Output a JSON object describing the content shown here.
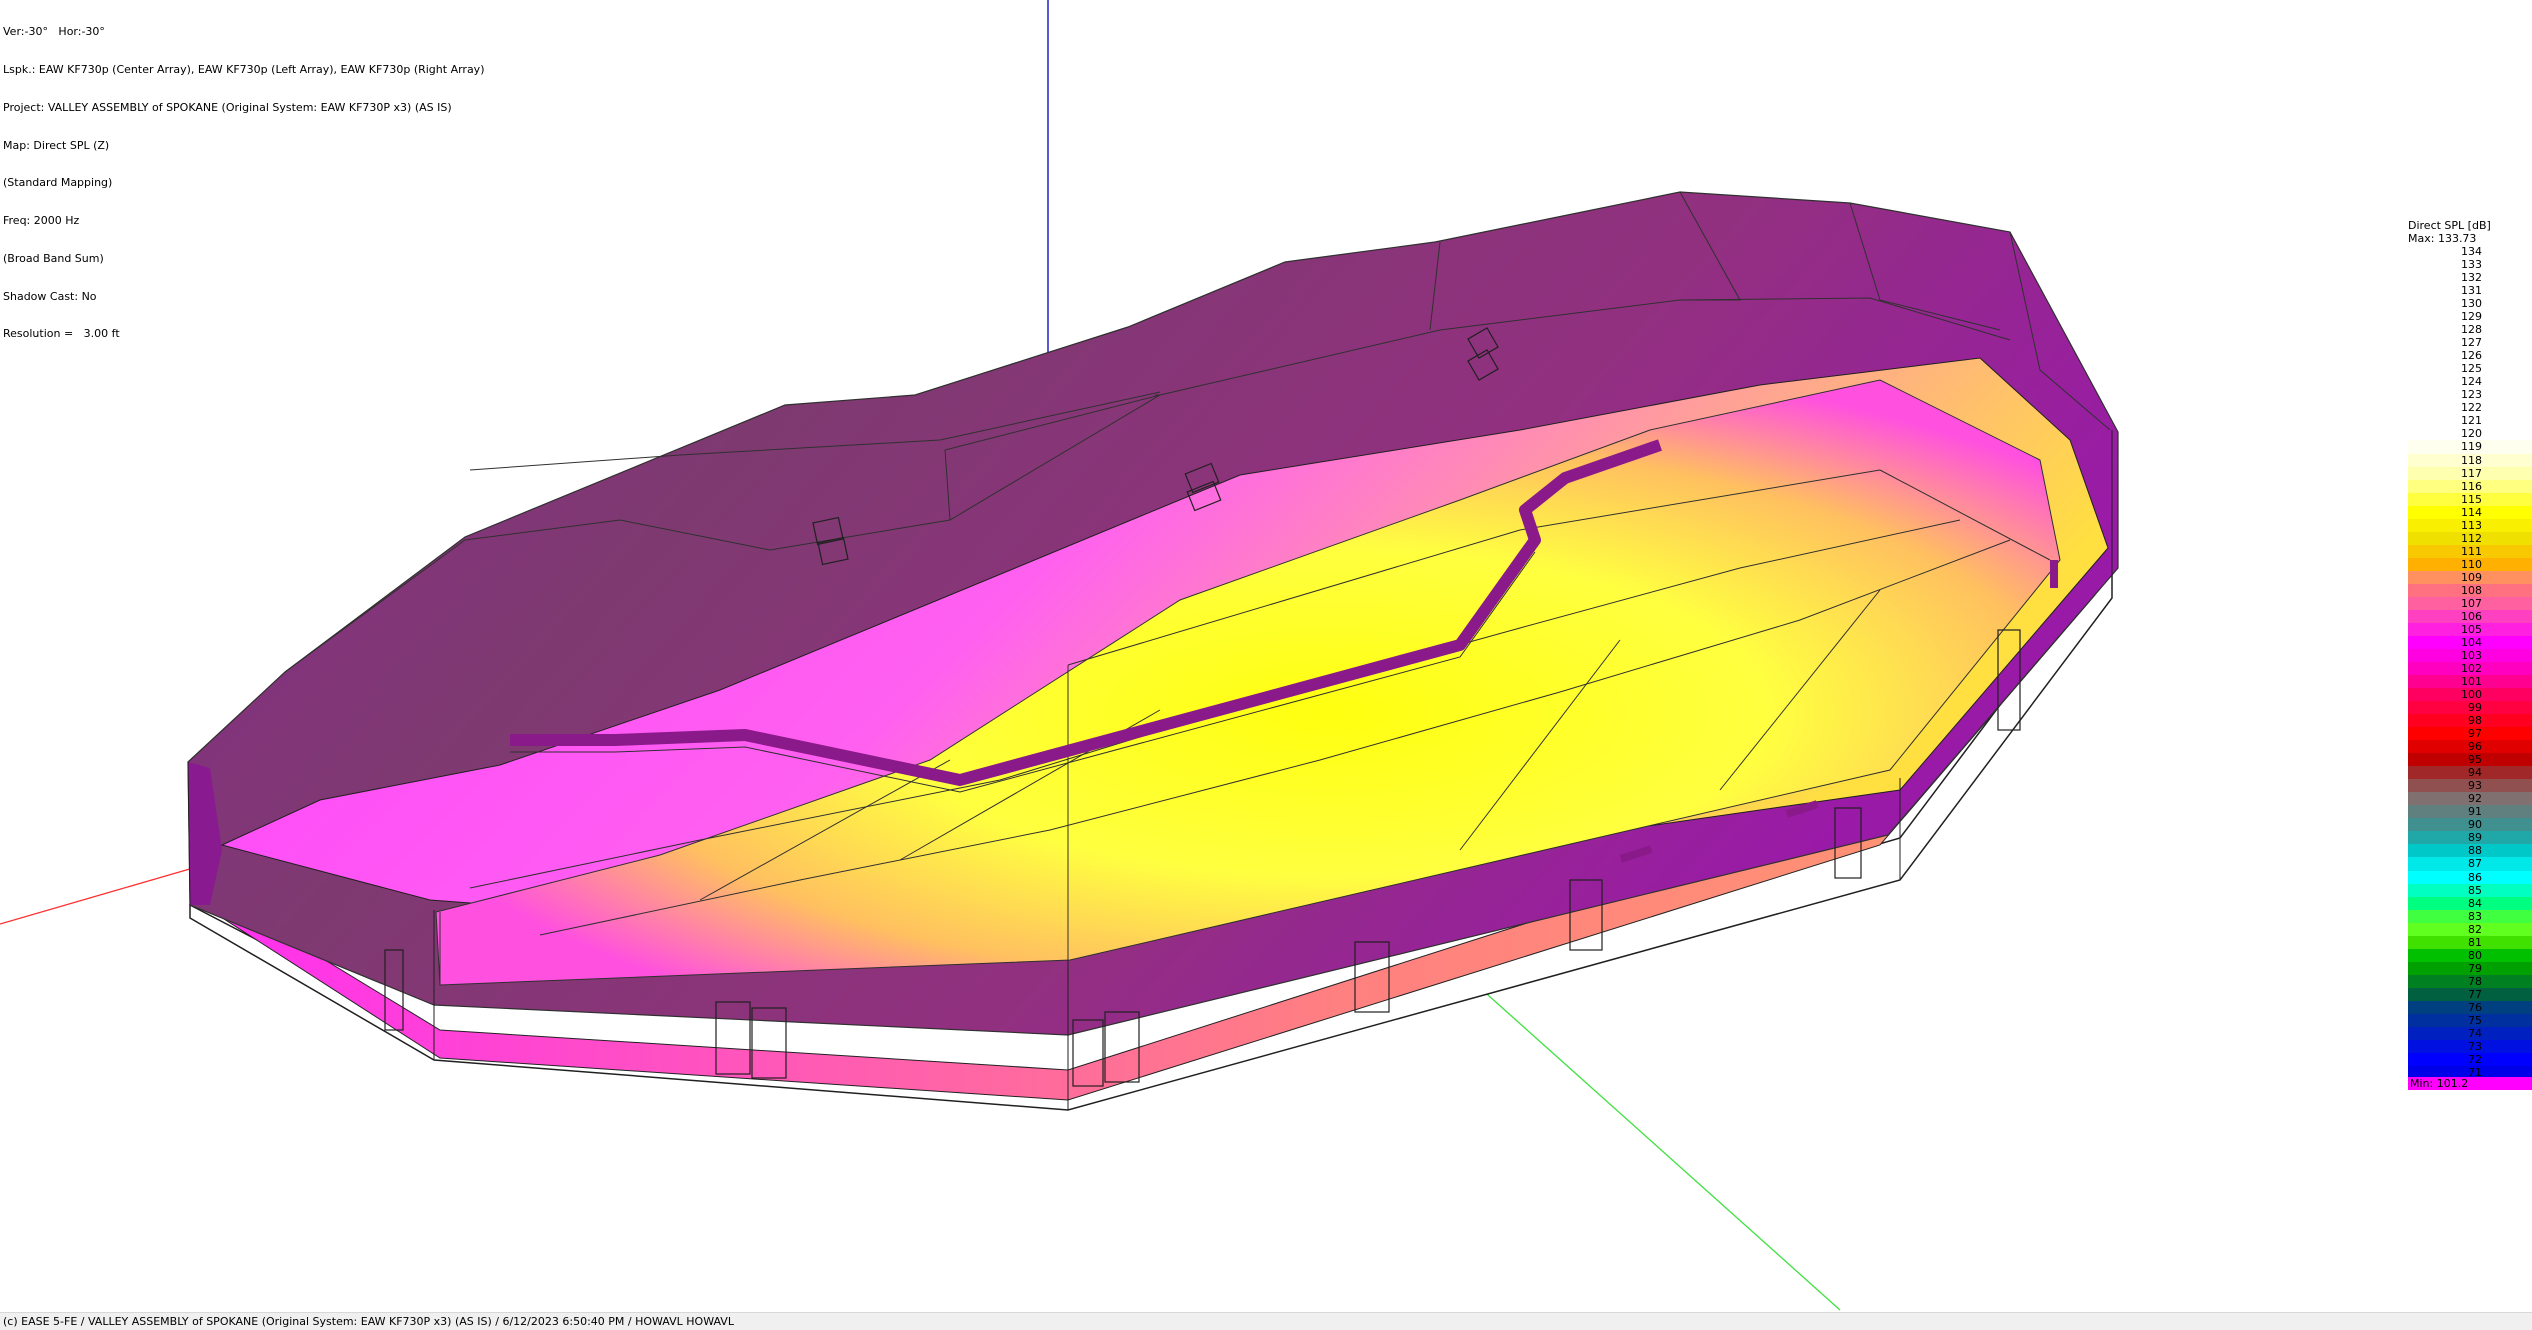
{
  "info": {
    "view": "Ver:-30°   Hor:-30°",
    "lspk": "Lspk.: EAW KF730p (Center Array), EAW KF730p (Left Array), EAW KF730p (Right Array)",
    "project": "Project: VALLEY ASSEMBLY of SPOKANE (Original System: EAW KF730P x3) (AS IS)",
    "map": "Map: Direct SPL (Z)",
    "mapping": "(Standard Mapping)",
    "freq": "Freq: 2000 Hz",
    "sum": "(Broad Band Sum)",
    "shadow": "Shadow Cast: No",
    "resolution": "Resolution =   3.00 ft"
  },
  "legend": {
    "title": "Direct SPL [dB]",
    "max": "Max:  133.73",
    "min": "Min:  101.2",
    "min_color": "#ff00ff",
    "entries": [
      {
        "label": "134",
        "color": "#ffffff"
      },
      {
        "label": "133",
        "color": "#ffffff"
      },
      {
        "label": "132",
        "color": "#ffffff"
      },
      {
        "label": "131",
        "color": "#ffffff"
      },
      {
        "label": "130",
        "color": "#ffffff"
      },
      {
        "label": "129",
        "color": "#ffffff"
      },
      {
        "label": "128",
        "color": "#ffffff"
      },
      {
        "label": "127",
        "color": "#ffffff"
      },
      {
        "label": "126",
        "color": "#ffffff"
      },
      {
        "label": "125",
        "color": "#ffffff"
      },
      {
        "label": "124",
        "color": "#ffffff"
      },
      {
        "label": "123",
        "color": "#ffffff"
      },
      {
        "label": "122",
        "color": "#ffffff"
      },
      {
        "label": "121",
        "color": "#ffffff"
      },
      {
        "label": "120",
        "color": "#ffffff"
      },
      {
        "label": "119",
        "color": "#fffff0"
      },
      {
        "label": "118",
        "color": "#ffffd0"
      },
      {
        "label": "117",
        "color": "#ffffb0"
      },
      {
        "label": "116",
        "color": "#ffff80"
      },
      {
        "label": "115",
        "color": "#ffff40"
      },
      {
        "label": "114",
        "color": "#ffff00"
      },
      {
        "label": "113",
        "color": "#f8f000"
      },
      {
        "label": "112",
        "color": "#f0e000"
      },
      {
        "label": "111",
        "color": "#f8c800"
      },
      {
        "label": "110",
        "color": "#ffb000"
      },
      {
        "label": "109",
        "color": "#ff9060"
      },
      {
        "label": "108",
        "color": "#ff7080"
      },
      {
        "label": "107",
        "color": "#ff60a0"
      },
      {
        "label": "106",
        "color": "#ff40c0"
      },
      {
        "label": "105",
        "color": "#ff20e0"
      },
      {
        "label": "104",
        "color": "#ff00ff"
      },
      {
        "label": "103",
        "color": "#ff00e0"
      },
      {
        "label": "102",
        "color": "#ff00c0"
      },
      {
        "label": "101",
        "color": "#ff0090"
      },
      {
        "label": "100",
        "color": "#ff0060"
      },
      {
        "label": "99",
        "color": "#ff0040"
      },
      {
        "label": "98",
        "color": "#ff0020"
      },
      {
        "label": "97",
        "color": "#ff0000"
      },
      {
        "label": "96",
        "color": "#e00000"
      },
      {
        "label": "95",
        "color": "#c00000"
      },
      {
        "label": "94",
        "color": "#a02828"
      },
      {
        "label": "93",
        "color": "#905050"
      },
      {
        "label": "92",
        "color": "#807070"
      },
      {
        "label": "91",
        "color": "#608080"
      },
      {
        "label": "90",
        "color": "#409090"
      },
      {
        "label": "89",
        "color": "#20a8a8"
      },
      {
        "label": "88",
        "color": "#00c8c8"
      },
      {
        "label": "87",
        "color": "#00e8e8"
      },
      {
        "label": "86",
        "color": "#00ffff"
      },
      {
        "label": "85",
        "color": "#00ffc0"
      },
      {
        "label": "84",
        "color": "#00ff80"
      },
      {
        "label": "83",
        "color": "#40ff40"
      },
      {
        "label": "82",
        "color": "#60ff20"
      },
      {
        "label": "81",
        "color": "#40e000"
      },
      {
        "label": "80",
        "color": "#00c000"
      },
      {
        "label": "79",
        "color": "#00a000"
      },
      {
        "label": "78",
        "color": "#008020"
      },
      {
        "label": "77",
        "color": "#006040"
      },
      {
        "label": "76",
        "color": "#004080"
      },
      {
        "label": "75",
        "color": "#0030a0"
      },
      {
        "label": "74",
        "color": "#0020c0"
      },
      {
        "label": "73",
        "color": "#0010e0"
      },
      {
        "label": "72",
        "color": "#0000ff"
      },
      {
        "label": "71",
        "color": "#0000e8"
      }
    ]
  },
  "statusbar": "(c) EASE 5-FE  / VALLEY ASSEMBLY of SPOKANE (Original System: EAW KF730P x3) (AS IS)  / 6/12/2023 6:50:40 PM / HOWAVL HOWAVL",
  "colors": {
    "axis_z": "#0000c0",
    "axis_x": "#ff3030",
    "axis_y": "#40e040",
    "wall": "#8a1a90",
    "ceiling": "#8a3a70",
    "floor_hot": "#ffff20",
    "floor_mid": "#ff40ff"
  }
}
